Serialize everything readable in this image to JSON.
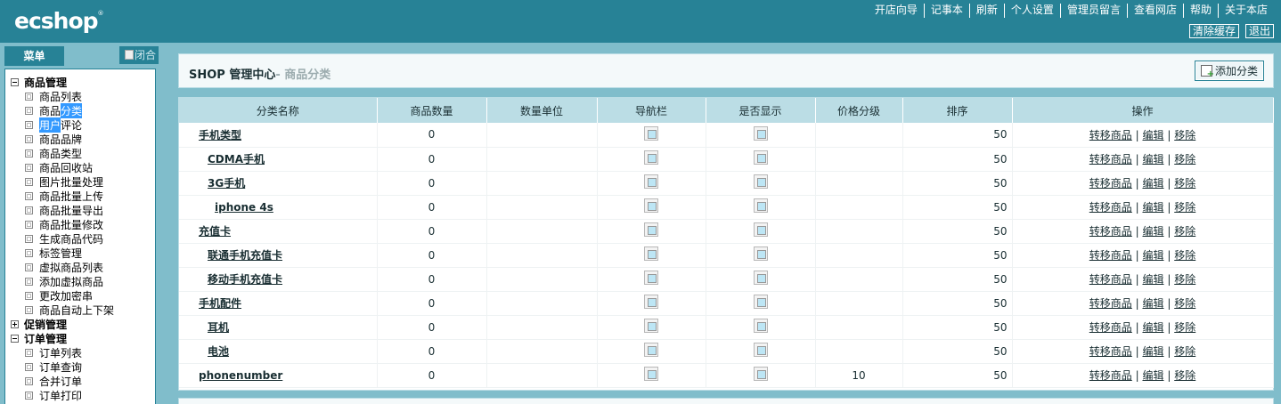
{
  "header": {
    "logo": "ecshop",
    "logo_mark": "®",
    "nav": [
      "开店向导",
      "记事本",
      "刷新",
      "个人设置",
      "管理员留言",
      "查看网店",
      "帮助",
      "关于本店"
    ],
    "buttons": [
      "清除缓存",
      "退出"
    ]
  },
  "menu": {
    "tab_label": "菜单",
    "toggle_label": "闭合",
    "groups": [
      {
        "label": "商品管理",
        "expanded": true,
        "items": [
          "商品列表",
          "商品分类",
          "用户评论",
          "商品品牌",
          "商品类型",
          "商品回收站",
          "图片批量处理",
          "商品批量上传",
          "商品批量导出",
          "商品批量修改",
          "生成商品代码",
          "标签管理",
          "虚拟商品列表",
          "添加虚拟商品",
          "更改加密串",
          "商品自动上下架"
        ]
      },
      {
        "label": "促销管理",
        "expanded": false,
        "items": []
      },
      {
        "label": "订单管理",
        "expanded": true,
        "items": [
          "订单列表",
          "订单查询",
          "合并订单",
          "订单打印"
        ]
      }
    ],
    "highlight_segments": {
      "item2_a": "商品",
      "item2_b": "分类",
      "item3_a": "用户",
      "item3_b": "评论"
    }
  },
  "main": {
    "title": "SHOP 管理中心",
    "subtitle": "- 商品分类",
    "add_button": "添加分类",
    "columns": [
      "分类名称",
      "商品数量",
      "数量单位",
      "导航栏",
      "是否显示",
      "价格分级",
      "排序",
      "操作"
    ],
    "rows": [
      {
        "name": "手机类型",
        "level": 0,
        "count": "0",
        "unit": "",
        "grade": "",
        "sort": "50"
      },
      {
        "name": "CDMA手机",
        "level": 1,
        "count": "0",
        "unit": "",
        "grade": "",
        "sort": "50"
      },
      {
        "name": "3G手机",
        "level": 1,
        "count": "0",
        "unit": "",
        "grade": "",
        "sort": "50"
      },
      {
        "name": "iphone 4s",
        "level": 2,
        "count": "0",
        "unit": "",
        "grade": "",
        "sort": "50"
      },
      {
        "name": "充值卡",
        "level": 0,
        "count": "0",
        "unit": "",
        "grade": "",
        "sort": "50"
      },
      {
        "name": "联通手机充值卡",
        "level": 1,
        "count": "0",
        "unit": "",
        "grade": "",
        "sort": "50"
      },
      {
        "name": "移动手机充值卡",
        "level": 1,
        "count": "0",
        "unit": "",
        "grade": "",
        "sort": "50"
      },
      {
        "name": "手机配件",
        "level": 0,
        "count": "0",
        "unit": "",
        "grade": "",
        "sort": "50"
      },
      {
        "name": "耳机",
        "level": 1,
        "count": "0",
        "unit": "",
        "grade": "",
        "sort": "50"
      },
      {
        "name": "电池",
        "level": 1,
        "count": "0",
        "unit": "",
        "grade": "",
        "sort": "50"
      },
      {
        "name": "phonenumber",
        "level": 0,
        "count": "0",
        "unit": "",
        "grade": "10",
        "sort": "50"
      }
    ],
    "ops": {
      "move": "转移商品",
      "edit": "编辑",
      "remove": "移除",
      "sep": "|"
    }
  },
  "colors": {
    "header": "#278296",
    "sidebar_bg": "#80bdcb",
    "table_head": "#bbdde5",
    "highlight": "#3399ff"
  }
}
